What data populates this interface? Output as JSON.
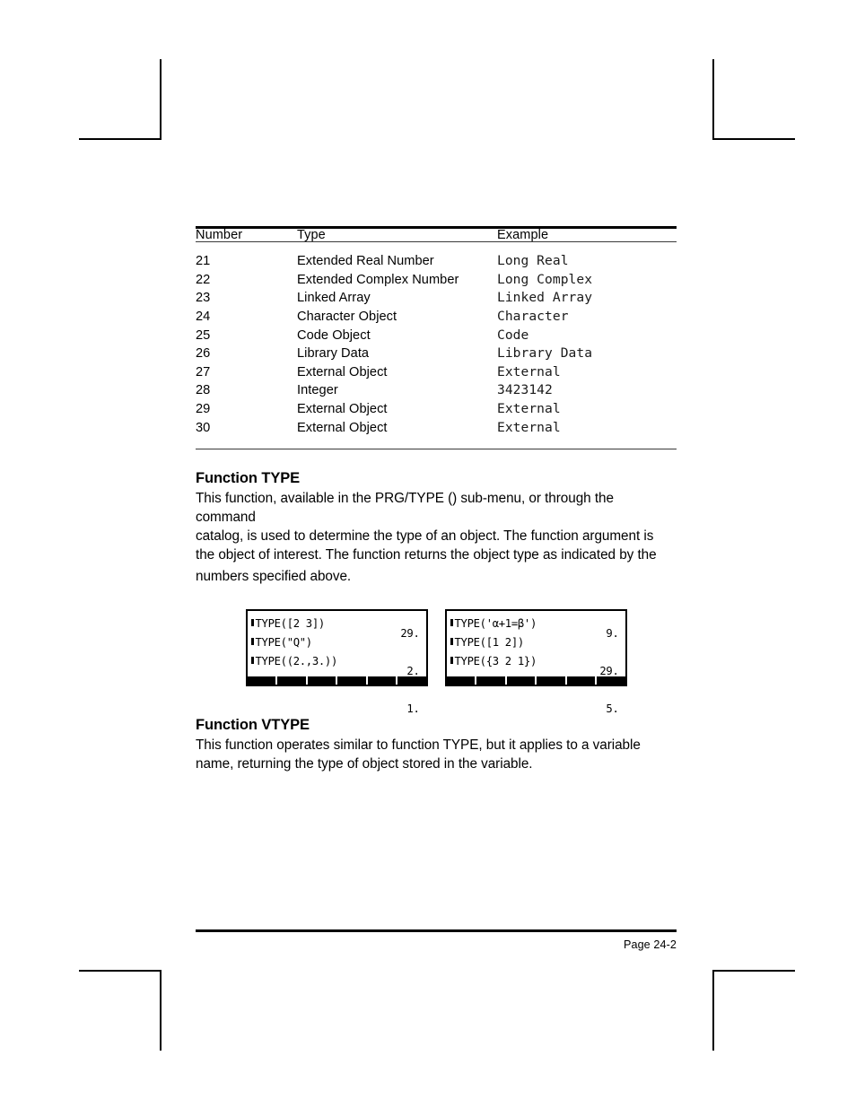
{
  "document": {
    "page_label": "Page 24-2"
  },
  "table": {
    "headers": [
      "Number",
      "Type",
      "Example"
    ],
    "rows": [
      {
        "number": "21",
        "type": "Extended Real Number",
        "example": "Long Real"
      },
      {
        "number": "22",
        "type": "Extended Complex Number",
        "example": "Long Complex"
      },
      {
        "number": "23",
        "type": "Linked Array",
        "example": "Linked Array"
      },
      {
        "number": "24",
        "type": "Character Object",
        "example": "Character"
      },
      {
        "number": "25",
        "type": "Code Object",
        "example": "Code"
      },
      {
        "number": "26",
        "type": "Library Data",
        "example": "Library Data"
      },
      {
        "number": "27",
        "type": "External Object",
        "example": "External"
      },
      {
        "number": "28",
        "type": "Integer",
        "example": "3423142"
      },
      {
        "number": "29",
        "type": "External Object",
        "example": "External"
      },
      {
        "number": "30",
        "type": "External Object",
        "example": "External"
      }
    ]
  },
  "sections": {
    "type": {
      "heading": "Function TYPE",
      "paragraph_lines": [
        "This function, available in the PRG/TYPE () sub-menu, or through the command",
        "catalog, is used to determine the type of an object.  The function argument is",
        "the object of interest.  The function returns the object type as indicated by the",
        "numbers specified above."
      ]
    },
    "vtype": {
      "heading": "Function VTYPE",
      "paragraph_lines": [
        "This function operates similar to function TYPE, but it applies to a variable",
        "name, returning the type of object stored in the variable."
      ]
    }
  },
  "calculators": [
    {
      "name": "calculator-screen-left",
      "lines": [
        {
          "command": "TYPE([2 3])",
          "result": "29."
        },
        {
          "command": "TYPE(\"Q\")",
          "result": "2."
        },
        {
          "command": "TYPE((2.,3.))",
          "result": "1."
        }
      ],
      "menu_keys": [
        "",
        "",
        "",
        "",
        "",
        ""
      ]
    },
    {
      "name": "calculator-screen-right",
      "lines": [
        {
          "command": "TYPE('α+1=β')",
          "result": "9."
        },
        {
          "command": "TYPE([1 2])",
          "result": "29."
        },
        {
          "command": "TYPE({3 2 1})",
          "result": "5."
        }
      ],
      "menu_keys": [
        "",
        "",
        "",
        "",
        "",
        ""
      ]
    }
  ]
}
